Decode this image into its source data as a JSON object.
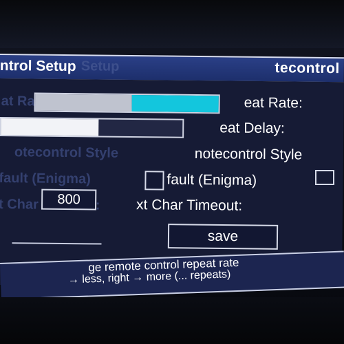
{
  "window": {
    "title_left": "ntrol Setup",
    "title_ghost": "Setup",
    "title_right": "tecontrol"
  },
  "settings": {
    "repeat_rate": {
      "label": "eat Rate:",
      "ghost": "at Rate:",
      "level": 0.5
    },
    "repeat_delay": {
      "label": "eat Delay:",
      "level": 0.55
    },
    "remotecontrol_style": {
      "label": "notecontrol Style",
      "ghost": "otecontrol Style"
    },
    "default": {
      "label": "fault (Enigma)",
      "ghost": "fault (Enigma)"
    },
    "next_char_timeout": {
      "label": "xt Char Timeout:",
      "ghost": "t Char Timeout:",
      "value": "800"
    }
  },
  "save_label": "save",
  "help": {
    "line1": "ge remote control repeat rate",
    "line2": "→ less, right → more (... repeats)"
  },
  "colors": {
    "accent": "#13c6dd",
    "panel": "#161b35",
    "titlebar": "#2a3f86"
  }
}
